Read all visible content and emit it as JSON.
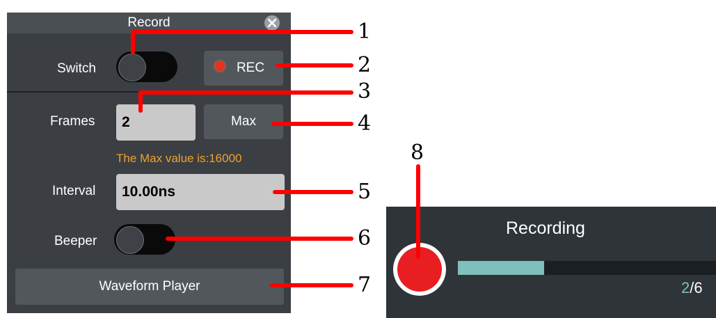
{
  "record_panel": {
    "title": "Record",
    "close_glyph": "x",
    "switch": {
      "label": "Switch",
      "on": false
    },
    "rec_button": {
      "label": "REC",
      "indicator_color": "#e6321e"
    },
    "frames": {
      "label": "Frames",
      "value": "2"
    },
    "max_button": {
      "label": "Max"
    },
    "max_hint": "The Max value is:16000",
    "interval": {
      "label": "Interval",
      "value": "10.00ns"
    },
    "beeper": {
      "label": "Beeper",
      "on": false
    },
    "waveform_player": {
      "label": "Waveform Player"
    }
  },
  "recording_panel": {
    "title": "Recording",
    "progress": {
      "current": "2",
      "separator": "/",
      "total": "6",
      "fraction": 0.333
    }
  },
  "callouts": [
    "1",
    "2",
    "3",
    "4",
    "5",
    "6",
    "7",
    "8"
  ],
  "colors": {
    "panel_bg": "#3b3f43",
    "accent_red": "#ff0000",
    "hint_orange": "#f0a030",
    "progress_teal": "#7fbfbc"
  }
}
